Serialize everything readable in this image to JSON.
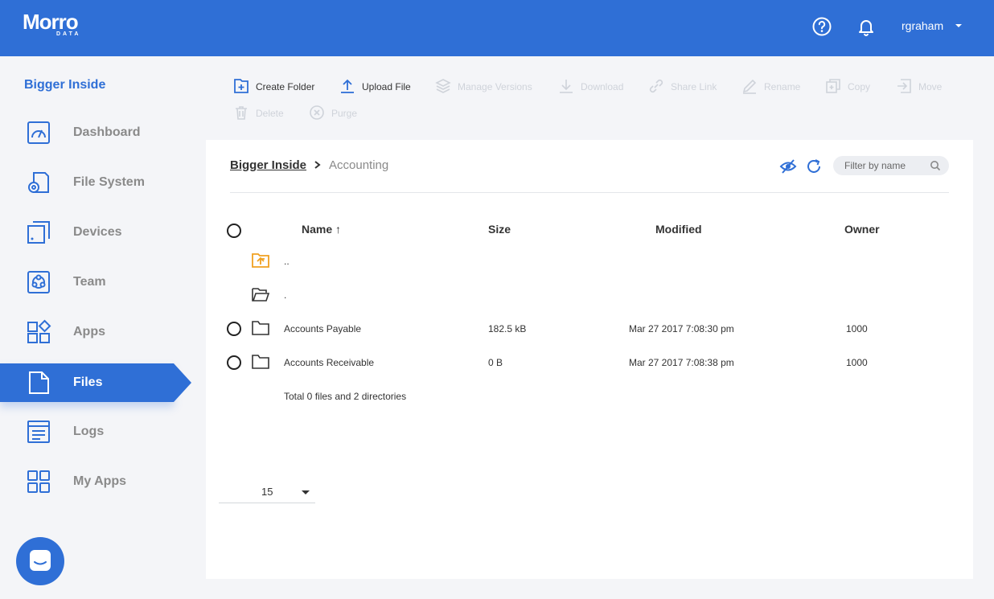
{
  "header": {
    "logo_word": "Morro",
    "logo_sub": "DATA",
    "username": "rgraham",
    "help_icon": "help-circle-icon",
    "notification_icon": "bell-icon"
  },
  "sidebar": {
    "org_name": "Bigger Inside",
    "items": [
      {
        "label": "Dashboard",
        "icon": "dashboard-icon"
      },
      {
        "label": "File System",
        "icon": "file-system-icon"
      },
      {
        "label": "Devices",
        "icon": "devices-icon"
      },
      {
        "label": "Team",
        "icon": "team-icon"
      },
      {
        "label": "Apps",
        "icon": "apps-icon"
      },
      {
        "label": "Files",
        "icon": "files-icon",
        "active": true
      },
      {
        "label": "Logs",
        "icon": "logs-icon"
      },
      {
        "label": "My Apps",
        "icon": "my-apps-icon"
      }
    ]
  },
  "toolbar": {
    "create_folder": "Create Folder",
    "upload_file": "Upload File",
    "manage_versions": "Manage Versions",
    "download": "Download",
    "share_link": "Share Link",
    "rename": "Rename",
    "copy": "Copy",
    "move": "Move",
    "delete": "Delete",
    "purge": "Purge"
  },
  "breadcrumb": {
    "root": "Bigger Inside",
    "current": "Accounting"
  },
  "filter": {
    "placeholder": "Filter by name"
  },
  "table": {
    "columns": {
      "name": "Name ↑",
      "size": "Size",
      "modified": "Modified",
      "owner": "Owner"
    },
    "nav_rows": [
      {
        "name": ".."
      },
      {
        "name": "."
      }
    ],
    "rows": [
      {
        "name": "Accounts Payable",
        "size": "182.5 kB",
        "modified": "Mar 27 2017 7:08:30 pm",
        "owner": "1000"
      },
      {
        "name": "Accounts Receivable",
        "size": "0 B",
        "modified": "Mar 27 2017 7:08:38 pm",
        "owner": "1000"
      }
    ],
    "summary": "Total 0 files and 2 directories"
  },
  "pagination": {
    "page_size": "15"
  },
  "colors": {
    "brand": "#2f6fd6",
    "parent_folder": "#f0a020",
    "disabled": "#cfd3da"
  }
}
